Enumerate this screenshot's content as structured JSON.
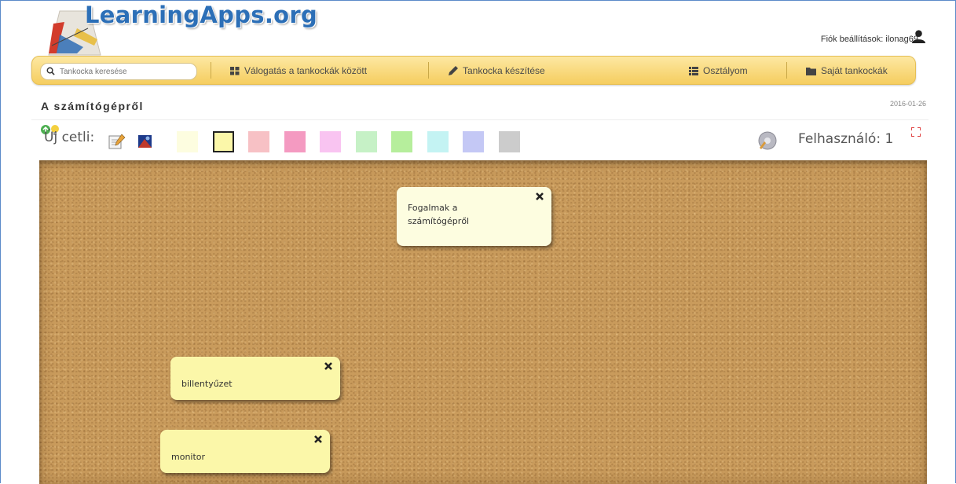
{
  "header": {
    "logo_text": "LearningApps.org",
    "account_label": "Fiók beállítások: ilonag69"
  },
  "nav": {
    "search_placeholder": "Tankocka keresése",
    "items": [
      {
        "label": "Válogatás a tankockák között",
        "icon": "grid-icon"
      },
      {
        "label": "Tankocka készítése",
        "icon": "pencil-icon"
      },
      {
        "label": "Osztályom",
        "icon": "list-icon"
      },
      {
        "label": "Saját tankockák",
        "icon": "folder-icon"
      }
    ]
  },
  "page": {
    "title": "A számítógépről",
    "date": "2016-01-26"
  },
  "toolbar": {
    "new_note_label": "Új cetli:",
    "user_count_label": "Felhasználó: 1",
    "colors": [
      "#fdfde0",
      "#fbf7a9",
      "#f7c1c5",
      "#f49ac1",
      "#f9c4f1",
      "#c6f1c6",
      "#b6ee9c",
      "#c4f3f3",
      "#c4c8f5",
      "#cccccc"
    ],
    "selected_color_index": 1
  },
  "notes": [
    {
      "text_lines": [
        "Fogalmak a",
        "számítógépről"
      ],
      "color": "#fdfde0"
    },
    {
      "text_lines": [
        "billentyűzet"
      ],
      "color": "#fbf7a9"
    },
    {
      "text_lines": [
        "monitor"
      ],
      "color": "#fbf7a9"
    }
  ]
}
